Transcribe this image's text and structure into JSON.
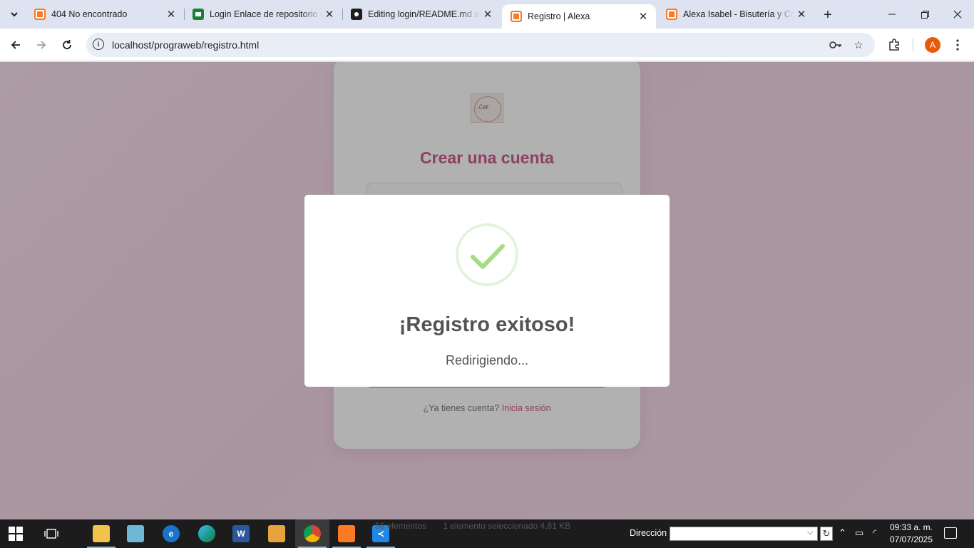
{
  "browser": {
    "tabs": [
      {
        "title": "404 No encontrado",
        "favicon": "xampp-icon",
        "active": false
      },
      {
        "title": "Login Enlace de repositorio de",
        "favicon": "sheets-icon",
        "active": false
      },
      {
        "title": "Editing login/README.md at",
        "favicon": "github-icon",
        "active": false
      },
      {
        "title": "Registro | Alexa",
        "favicon": "xampp-icon",
        "active": true
      },
      {
        "title": "Alexa Isabel - Bisutería y Cos",
        "favicon": "xampp-icon",
        "active": false
      }
    ],
    "url": "localhost/prograweb/registro.html",
    "profile_initial": "A"
  },
  "page": {
    "title": "Crear una cuenta",
    "login_prompt": "¿Ya tienes cuenta?",
    "login_link": "Inicia sesión",
    "accent_color": "#c2447d"
  },
  "modal": {
    "title": "¡Registro exitoso!",
    "text": "Redirigiendo...",
    "icon": "success-check-icon",
    "icon_color": "#a5dc86"
  },
  "taskbar": {
    "hint_status": "56 elementos",
    "hint_selection": "1 elemento seleccionado  4,81 KB",
    "address_label": "Dirección",
    "time": "09:33 a. m.",
    "date": "07/07/2025"
  }
}
